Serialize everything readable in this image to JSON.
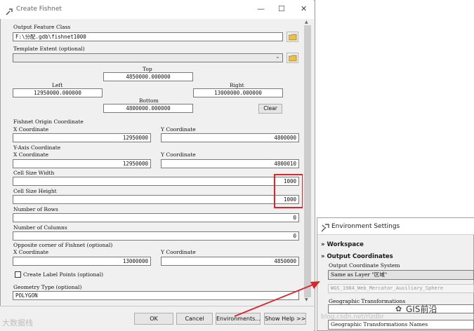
{
  "dialog": {
    "title": "Create Fishnet",
    "window_controls": {
      "minimize": "—",
      "maximize": "☐",
      "close": "✕"
    },
    "output_feature_class": {
      "label": "Output Feature Class",
      "value": "F:\\分配.gdb\\fishnet1000"
    },
    "template_extent": {
      "label": "Template Extent (optional)",
      "value": ""
    },
    "extent": {
      "top_label": "Top",
      "top_value": "4850000.000000",
      "left_label": "Left",
      "left_value": "12950000.000000",
      "right_label": "Right",
      "right_value": "13000000.000000",
      "bottom_label": "Bottom",
      "bottom_value": "4800000.000000",
      "clear_button": "Clear"
    },
    "origin": {
      "label": "Fishnet Origin Coordinate",
      "x_label": "X Coordinate",
      "x_value": "12950000",
      "y_label": "Y Coordinate",
      "y_value": "4800000"
    },
    "y_axis": {
      "label": "Y-Axis Coordinate",
      "x_label": "X Coordinate",
      "x_value": "12950000",
      "y_label": "Y Coordinate",
      "y_value": "4800010"
    },
    "cell_width": {
      "label": "Cell Size Width",
      "value": "1000"
    },
    "cell_height": {
      "label": "Cell Size Height",
      "value": "1000"
    },
    "rows": {
      "label": "Number of Rows",
      "value": "0"
    },
    "columns": {
      "label": "Number of Columns",
      "value": "0"
    },
    "opposite": {
      "label": "Opposite corner of Fishnet (optional)",
      "x_label": "X Coordinate",
      "x_value": "13000000",
      "y_label": "Y Coordinate",
      "y_value": "4850000"
    },
    "label_points": {
      "label": "Create Label Points (optional)",
      "checked": false
    },
    "geometry": {
      "label": "Geometry Type (optional)",
      "value": "POLYGON"
    },
    "buttons": {
      "ok": "OK",
      "cancel": "Cancel",
      "environments": "Environments...",
      "show_help": "Show Help >>"
    }
  },
  "env": {
    "title": "Environment Settings",
    "workspace": "Workspace",
    "output_coordinates": "Output Coordinates",
    "ocs_label": "Output Coordinate System",
    "ocs_value": "Same as Layer \"区域\"",
    "ocs_name": "WGS_1984_Web_Mercator_Auxiliary_Sphere",
    "geo_transform_label": "Geographic Transformations",
    "geo_transform_names": "Geographic Transformations Names"
  },
  "watermarks": {
    "bottom_left": "大数据栈",
    "brand": "GIS前沿",
    "url": "blog.csdn.net/rlzdbr"
  },
  "colors": {
    "highlight_box": "#d9262b",
    "arrow": "#d9262b",
    "dialog_bg": "#f0f0f0"
  }
}
